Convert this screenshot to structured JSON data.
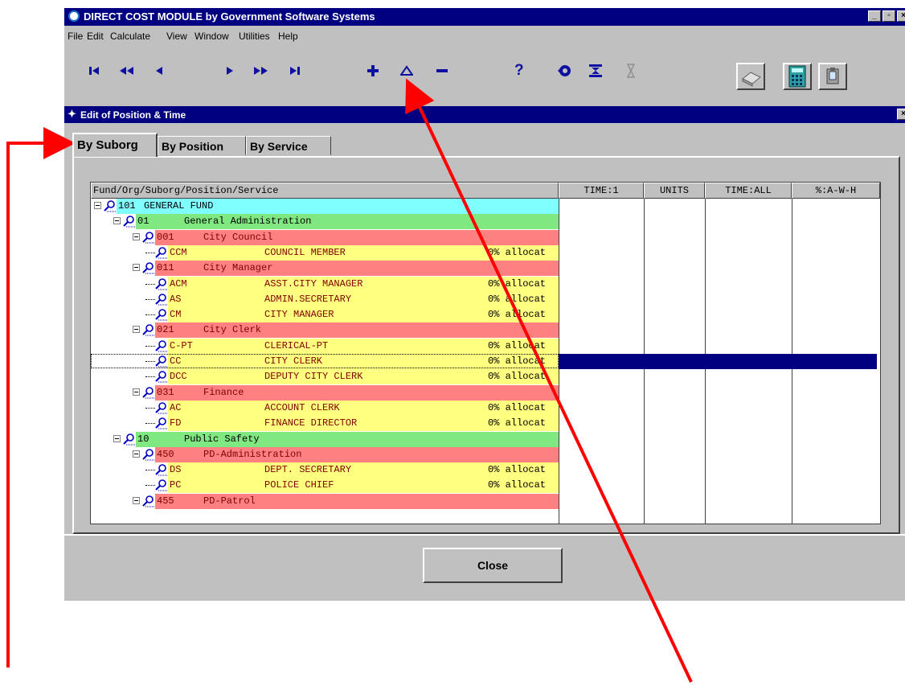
{
  "window": {
    "title": "DIRECT COST MODULE by Government Software Systems"
  },
  "menu": [
    "File",
    "Edit",
    "Calculate",
    "View",
    "Window",
    "Utilities",
    "Help"
  ],
  "toolbar": {
    "nav_icons": [
      "first-record-icon",
      "previous-page-icon",
      "previous-record-icon",
      "next-record-icon",
      "next-page-icon",
      "last-record-icon"
    ],
    "edit_icons": [
      "insert-record-icon",
      "expand-icon",
      "delete-record-icon"
    ],
    "help_label": "?",
    "other_icons": [
      "refresh-icon",
      "collapse-all-icon",
      "hourglass-icon",
      "printer-icon",
      "calculator-icon",
      "clipboard-icon"
    ]
  },
  "child_window": {
    "title": "Edit of Position & Time"
  },
  "tabs": [
    "By Suborg",
    "By Position",
    "By Service"
  ],
  "grid": {
    "columns": [
      "Fund/Org/Suborg/Position/Service",
      "TIME:1",
      "UNITS",
      "TIME:ALL",
      "%:A-W-H"
    ],
    "rows": [
      {
        "level": 0,
        "code": "101",
        "name": "GENERAL FUND",
        "alloc": "",
        "color": "#80ffff"
      },
      {
        "level": 1,
        "code": "01",
        "name": "General Administration",
        "alloc": "",
        "color": "#80e880"
      },
      {
        "level": 2,
        "code": "001",
        "name": "City Council",
        "alloc": "",
        "color": "#ff8080"
      },
      {
        "level": 3,
        "code": "CCM",
        "name": "COUNCIL MEMBER",
        "alloc": "0% allocat",
        "color": "#ffff80"
      },
      {
        "level": 2,
        "code": "011",
        "name": "City Manager",
        "alloc": "",
        "color": "#ff8080"
      },
      {
        "level": 3,
        "code": "ACM",
        "name": "ASST.CITY MANAGER",
        "alloc": "0% allocat",
        "color": "#ffff80"
      },
      {
        "level": 3,
        "code": "AS",
        "name": "ADMIN.SECRETARY",
        "alloc": "0% allocat",
        "color": "#ffff80"
      },
      {
        "level": 3,
        "code": "CM",
        "name": "CITY MANAGER",
        "alloc": "0% allocat",
        "color": "#ffff80"
      },
      {
        "level": 2,
        "code": "021",
        "name": "City Clerk",
        "alloc": "",
        "color": "#ff8080"
      },
      {
        "level": 3,
        "code": "C-PT",
        "name": "CLERICAL-PT",
        "alloc": "0% allocat",
        "color": "#ffff80"
      },
      {
        "level": 3,
        "code": "CC",
        "name": "CITY CLERK",
        "alloc": "0% allocat",
        "color": "#ffff80"
      },
      {
        "level": 3,
        "code": "DCC",
        "name": "DEPUTY CITY CLERK",
        "alloc": "0% allocat",
        "color": "#ffff80"
      },
      {
        "level": 2,
        "code": "031",
        "name": "Finance",
        "alloc": "",
        "color": "#ff8080"
      },
      {
        "level": 3,
        "code": "AC",
        "name": "ACCOUNT CLERK",
        "alloc": "0% allocat",
        "color": "#ffff80"
      },
      {
        "level": 3,
        "code": "FD",
        "name": "FINANCE DIRECTOR",
        "alloc": "0% allocat",
        "color": "#ffff80"
      },
      {
        "level": 1,
        "code": "10",
        "name": "Public Safety",
        "alloc": "",
        "color": "#80e880"
      },
      {
        "level": 2,
        "code": "450",
        "name": "PD-Administration",
        "alloc": "",
        "color": "#ff8080"
      },
      {
        "level": 3,
        "code": "DS",
        "name": "DEPT. SECRETARY",
        "alloc": "0% allocat",
        "color": "#ffff80"
      },
      {
        "level": 3,
        "code": "PC",
        "name": "POLICE CHIEF",
        "alloc": "0% allocat",
        "color": "#ffff80"
      },
      {
        "level": 2,
        "code": "455",
        "name": "PD-Patrol",
        "alloc": "",
        "color": "#ff8080"
      }
    ],
    "selected_row": 10
  },
  "close_label": "Close",
  "annotation_color": "#ff0000",
  "text_color": "#800000",
  "selection_color": "#000080"
}
